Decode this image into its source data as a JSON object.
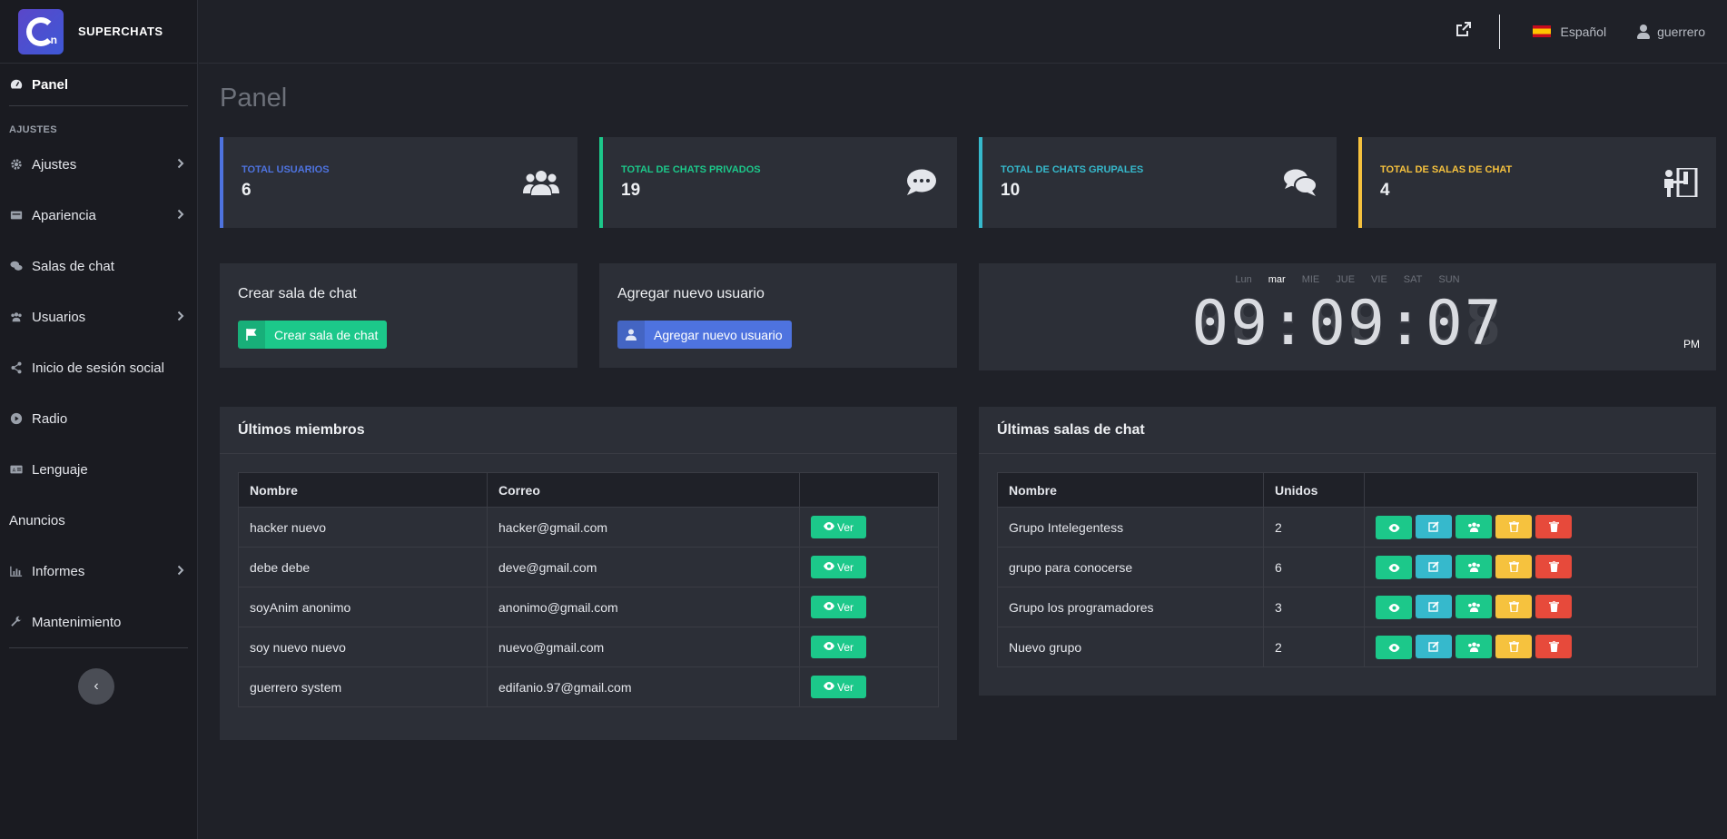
{
  "brand": {
    "name": "SUPERCHATS",
    "logo_letter": "n"
  },
  "sidebar": {
    "panel": "Panel",
    "section": "AJUSTES",
    "items": [
      {
        "label": "Ajustes",
        "icon": "gear-icon",
        "chevron": true
      },
      {
        "label": "Apariencia",
        "icon": "appearance-icon",
        "chevron": true
      },
      {
        "label": "Salas de chat",
        "icon": "chat-icon",
        "chevron": false
      },
      {
        "label": "Usuarios",
        "icon": "users-icon",
        "chevron": true
      },
      {
        "label": "Inicio de sesión social",
        "icon": "share-icon",
        "chevron": false
      },
      {
        "label": "Radio",
        "icon": "play-icon",
        "chevron": false
      },
      {
        "label": "Lenguaje",
        "icon": "language-icon",
        "chevron": false
      },
      {
        "label": "Anuncios",
        "icon": "",
        "chevron": false
      },
      {
        "label": "Informes",
        "icon": "chart-icon",
        "chevron": true
      },
      {
        "label": "Mantenimiento",
        "icon": "wrench-icon",
        "chevron": false
      }
    ]
  },
  "topbar": {
    "language": "Español",
    "user": "guerrero"
  },
  "page_title": "Panel",
  "stats": [
    {
      "label": "TOTAL USUARIOS",
      "value": "6",
      "color": "#4e73df",
      "icon": "users-icon"
    },
    {
      "label": "TOTAL DE CHATS PRIVADOS",
      "value": "19",
      "color": "#1cc88a",
      "icon": "comment-icon"
    },
    {
      "label": "TOTAL DE CHATS GRUPALES",
      "value": "10",
      "color": "#36b9cc",
      "icon": "comments-icon"
    },
    {
      "label": "TOTAL DE SALAS DE CHAT",
      "value": "4",
      "color": "#f6c23e",
      "icon": "room-icon"
    }
  ],
  "actions": {
    "create_room": {
      "title": "Crear sala de chat",
      "button": "Crear sala de chat",
      "color": "#1cc88a"
    },
    "add_user": {
      "title": "Agregar nuevo usuario",
      "button": "Agregar nuevo usuario",
      "color": "#4e73df"
    }
  },
  "clock": {
    "days": [
      "Lun",
      "mar",
      "MIE",
      "JUE",
      "VIE",
      "SAT",
      "SUN"
    ],
    "current_day": "mar",
    "time": "09:09:07",
    "ampm": "PM"
  },
  "members": {
    "title": "Últimos miembros",
    "headers": [
      "Nombre",
      "Correo",
      ""
    ],
    "button": "Ver",
    "rows": [
      {
        "name": "hacker nuevo",
        "email": "hacker@gmail.com"
      },
      {
        "name": "debe debe",
        "email": "deve@gmail.com"
      },
      {
        "name": "soyAnim anonimo",
        "email": "anonimo@gmail.com"
      },
      {
        "name": "soy nuevo nuevo",
        "email": "nuevo@gmail.com"
      },
      {
        "name": "guerrero system",
        "email": "edifanio.97@gmail.com"
      }
    ]
  },
  "rooms": {
    "title": "Últimas salas de chat",
    "headers": [
      "Nombre",
      "Unidos",
      ""
    ],
    "rows": [
      {
        "name": "Grupo Intelegentess",
        "joined": "2"
      },
      {
        "name": "grupo para conocerse",
        "joined": "6"
      },
      {
        "name": "Grupo los programadores",
        "joined": "3"
      },
      {
        "name": "Nuevo grupo",
        "joined": "2"
      }
    ]
  },
  "colors": {
    "green": "#1cc88a",
    "blue": "#4e73df",
    "cyan": "#36b9cc",
    "yellow": "#f6c23e",
    "red": "#e74a3b"
  }
}
